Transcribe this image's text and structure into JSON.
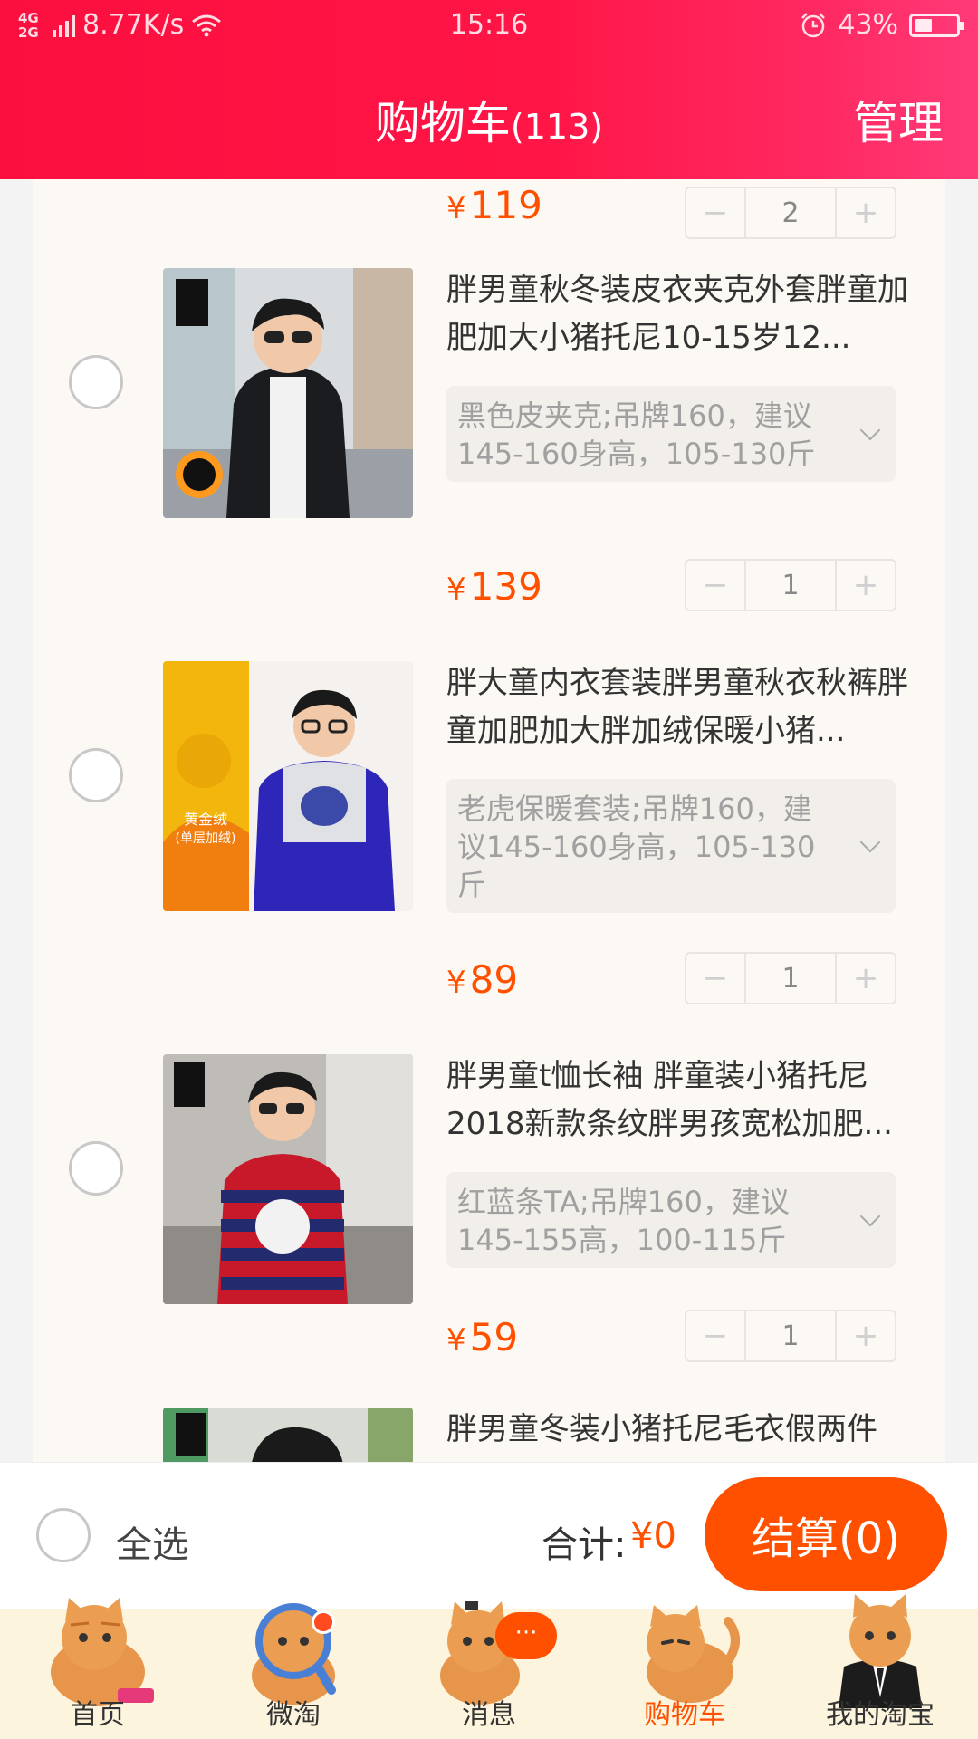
{
  "status_bar": {
    "network": "4G 2G",
    "speed": "8.77K/s",
    "time": "15:16",
    "battery": "43%",
    "battery_level": 0.43
  },
  "header": {
    "title": "购物车",
    "count": "(113)",
    "manage_label": "管理"
  },
  "cart": {
    "top_item": {
      "price": "119",
      "quantity": "2"
    },
    "items": [
      {
        "title": "胖男童秋冬装皮衣夹克外套胖童加肥加大小猪托尼10-15岁12...",
        "sku": "黑色皮夹克;吊牌160，建议145-160身高，105-130斤",
        "price": "139",
        "quantity": "1",
        "image": "boy-black-leather-jacket"
      },
      {
        "title": "胖大童内衣套装胖男童秋衣秋裤胖童加肥加大胖加绒保暖小猪...",
        "sku": "老虎保暖套装;吊牌160，建议145-160身高，105-130斤",
        "price": "89",
        "quantity": "1",
        "image": "boy-tiger-thermal-set",
        "image_text": "黄金绒（单层加绒）"
      },
      {
        "title": "胖男童t恤长袖 胖童装小猪托尼2018新款条纹胖男孩宽松加肥...",
        "sku": "红蓝条TA;吊牌160，建议145-155高，100-115斤",
        "price": "59",
        "quantity": "1",
        "image": "boy-striped-sweater"
      },
      {
        "title": "胖男童冬装小猪托尼毛衣假两件",
        "image": "boy-sweater"
      }
    ],
    "currency_symbol": "¥",
    "minus_symbol": "−",
    "plus_symbol": "+"
  },
  "checkout": {
    "select_all": "全选",
    "total_label": "合计:",
    "total_value": "¥0",
    "pay_label": "结算(0)"
  },
  "tabbar": {
    "tabs": [
      {
        "label": "首页",
        "icon": "cat-home-icon"
      },
      {
        "label": "微淘",
        "icon": "cat-magnifier-icon"
      },
      {
        "label": "消息",
        "icon": "cat-message-icon",
        "badge": "···"
      },
      {
        "label": "购物车",
        "icon": "cat-cart-icon",
        "active": true
      },
      {
        "label": "我的淘宝",
        "icon": "cat-suit-icon"
      }
    ]
  },
  "colors": {
    "header": "#ff1546",
    "accent": "#ff5000",
    "list_bg": "#fcf8f3",
    "tabbar_bg": "#fdf4de"
  }
}
